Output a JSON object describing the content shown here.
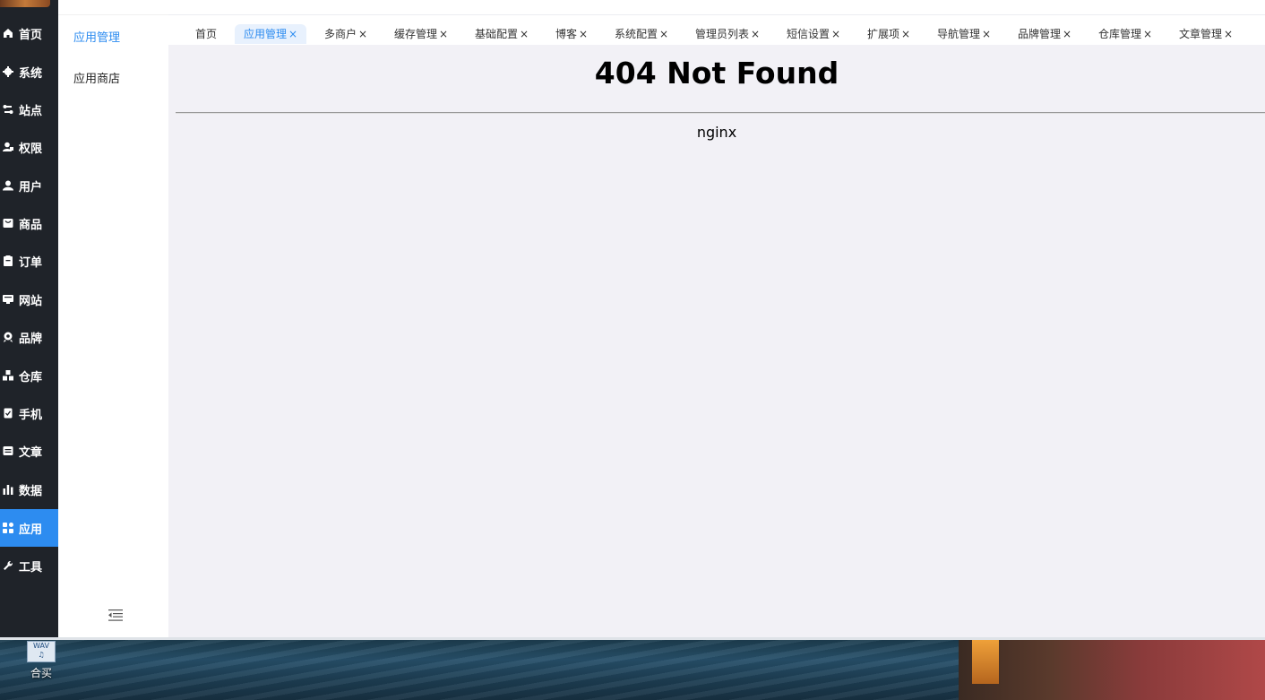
{
  "rail": {
    "items": [
      {
        "label": "首页",
        "icon": "home-icon"
      },
      {
        "label": "系统",
        "icon": "gear-icon"
      },
      {
        "label": "站点",
        "icon": "site-icon"
      },
      {
        "label": "权限",
        "icon": "permission-icon"
      },
      {
        "label": "用户",
        "icon": "user-icon"
      },
      {
        "label": "商品",
        "icon": "goods-icon"
      },
      {
        "label": "订单",
        "icon": "order-icon"
      },
      {
        "label": "网站",
        "icon": "website-icon"
      },
      {
        "label": "品牌",
        "icon": "brand-icon"
      },
      {
        "label": "仓库",
        "icon": "warehouse-icon"
      },
      {
        "label": "手机",
        "icon": "mobile-icon"
      },
      {
        "label": "文章",
        "icon": "article-icon"
      },
      {
        "label": "数据",
        "icon": "chart-icon"
      },
      {
        "label": "应用",
        "icon": "apps-icon"
      },
      {
        "label": "工具",
        "icon": "wrench-icon"
      }
    ],
    "active_index": 13
  },
  "submenu": {
    "items": [
      {
        "label": "应用管理"
      },
      {
        "label": "应用商店"
      }
    ],
    "collapse_icon": "menu-collapse-icon"
  },
  "tabs": [
    {
      "label": "首页",
      "closable": false
    },
    {
      "label": "应用管理",
      "closable": true,
      "active": true
    },
    {
      "label": "多商户",
      "closable": true
    },
    {
      "label": "缓存管理",
      "closable": true
    },
    {
      "label": "基础配置",
      "closable": true
    },
    {
      "label": "博客",
      "closable": true
    },
    {
      "label": "系统配置",
      "closable": true
    },
    {
      "label": "管理员列表",
      "closable": true
    },
    {
      "label": "短信设置",
      "closable": true
    },
    {
      "label": "扩展项",
      "closable": true
    },
    {
      "label": "导航管理",
      "closable": true
    },
    {
      "label": "品牌管理",
      "closable": true
    },
    {
      "label": "仓库管理",
      "closable": true
    },
    {
      "label": "文章管理",
      "closable": true
    }
  ],
  "tab_close_glyph": "×",
  "content": {
    "title": "404 Not Found",
    "server": "nginx"
  },
  "desktop": {
    "icon_badge": "WAV",
    "icon_label": "合买",
    "icon": "audio-file-icon"
  },
  "colors": {
    "rail_bg": "#1f2329",
    "accent": "#2d8cf0",
    "content_bg": "#f2f1f6"
  }
}
